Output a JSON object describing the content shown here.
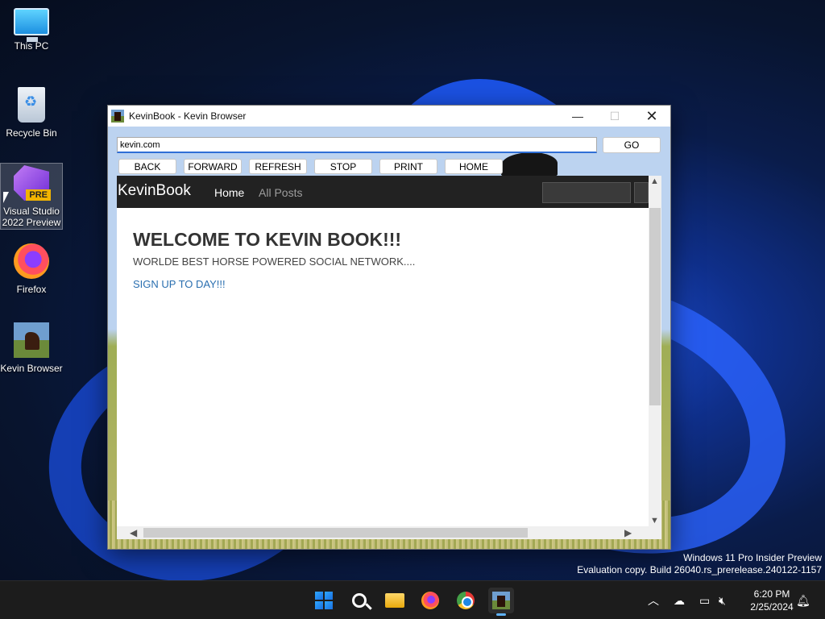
{
  "desktop": {
    "icons": [
      {
        "label": "This PC"
      },
      {
        "label": "Recycle Bin"
      },
      {
        "label_line1": "Visual Studio",
        "label_line2": "2022 Preview",
        "badge": "PRE"
      },
      {
        "label": "Firefox"
      },
      {
        "label": "Kevin Browser"
      }
    ],
    "watermark": {
      "line1": "Windows 11 Pro Insider Preview",
      "line2": "Evaluation copy. Build 26040.rs_prerelease.240122-1157"
    }
  },
  "window": {
    "title": "KevinBook - Kevin Browser",
    "controls": {
      "minimize": "—",
      "maximize": "☐",
      "close": "✕"
    }
  },
  "browser": {
    "address_value": "kevin.com",
    "go_label": "GO",
    "nav_buttons": [
      "BACK",
      "FORWARD",
      "REFRESH",
      "STOP",
      "PRINT",
      "HOME"
    ]
  },
  "site": {
    "brand": "KevinBook",
    "nav": {
      "home": "Home",
      "all_posts": "All Posts"
    },
    "heading": "WELCOME TO KEVIN BOOK!!!",
    "tagline": "WORLDE BEST HORSE POWERED SOCIAL NETWORK....",
    "signup_link": "SIGN UP TO DAY!!!"
  },
  "taskbar": {
    "clock_time": "6:20 PM",
    "clock_date": "2/25/2024",
    "tray_icons": [
      "chevron-up-icon",
      "cloud-offline-icon",
      "network-icon",
      "speaker-muted-icon",
      "bell-icon"
    ],
    "pinned": [
      "start-icon",
      "search-icon",
      "file-explorer-icon",
      "firefox-icon",
      "chrome-icon",
      "kevin-browser-icon"
    ]
  },
  "colors": {
    "site_nav_bg": "#222222",
    "link_blue": "#2a6fb0",
    "address_focus": "#2f6fd6",
    "taskbar_bg": "#1c1c1c"
  }
}
